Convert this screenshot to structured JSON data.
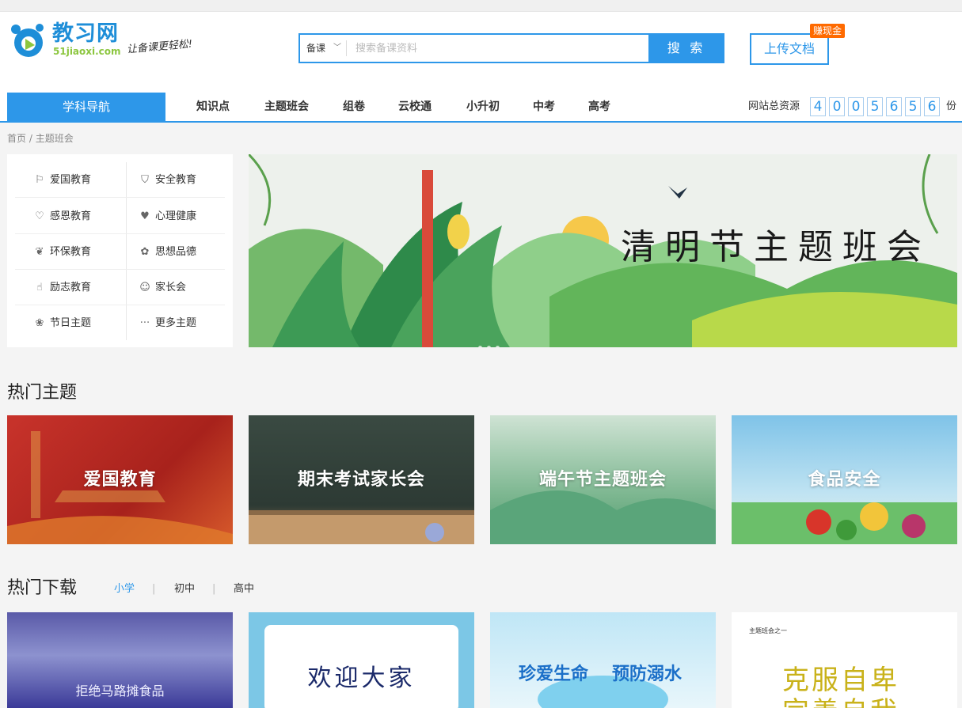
{
  "header": {
    "logo_cn": "教习网",
    "logo_en": "51jiaoxi.com",
    "slogan": "让备课更轻松!",
    "search": {
      "category": "备课",
      "placeholder": "搜索备课资料",
      "button": "搜 索"
    },
    "upload": {
      "label": "上传文档",
      "badge": "赚现金"
    }
  },
  "nav": {
    "subject_nav": "学科导航",
    "items": [
      "知识点",
      "主题班会",
      "组卷",
      "云校通",
      "小升初",
      "中考",
      "高考"
    ],
    "resources_label": "网站总资源",
    "resources_digits": [
      "4",
      "0",
      "0",
      "5",
      "6",
      "5",
      "6"
    ],
    "resources_unit": "份"
  },
  "breadcrumb": {
    "home": "首页 /",
    "current": "主题班会"
  },
  "topic_menu": [
    {
      "label": "爱国教育",
      "icon": "flag-icon"
    },
    {
      "label": "安全教育",
      "icon": "shield-icon"
    },
    {
      "label": "感恩教育",
      "icon": "heart-icon"
    },
    {
      "label": "心理健康",
      "icon": "heartbeat-icon"
    },
    {
      "label": "环保教育",
      "icon": "leaf-icon"
    },
    {
      "label": "思想品德",
      "icon": "brain-icon"
    },
    {
      "label": "励志教育",
      "icon": "thumbs-up-icon"
    },
    {
      "label": "家长会",
      "icon": "family-icon"
    },
    {
      "label": "节日主题",
      "icon": "balloon-icon"
    },
    {
      "label": "更多主题",
      "icon": "more-icon"
    }
  ],
  "banner": {
    "title": "清明节主题班会"
  },
  "hot_topics": {
    "title": "热门主题",
    "items": [
      "爱国教育",
      "期末考试家长会",
      "端午节主题班会",
      "食品安全"
    ]
  },
  "hot_downloads": {
    "title": "热门下载",
    "tabs": [
      "小学",
      "初中",
      "高中"
    ],
    "active_tab": "小学",
    "items": [
      "拒绝马路摊食品",
      "欢迎大家",
      "珍爱生命",
      "预防溺水",
      "主题班会之一",
      "克服自卑",
      "完善自我"
    ]
  },
  "colors": {
    "accent": "#2d97e9",
    "badge": "#ff6a00",
    "logo_green": "#8cc63f"
  }
}
